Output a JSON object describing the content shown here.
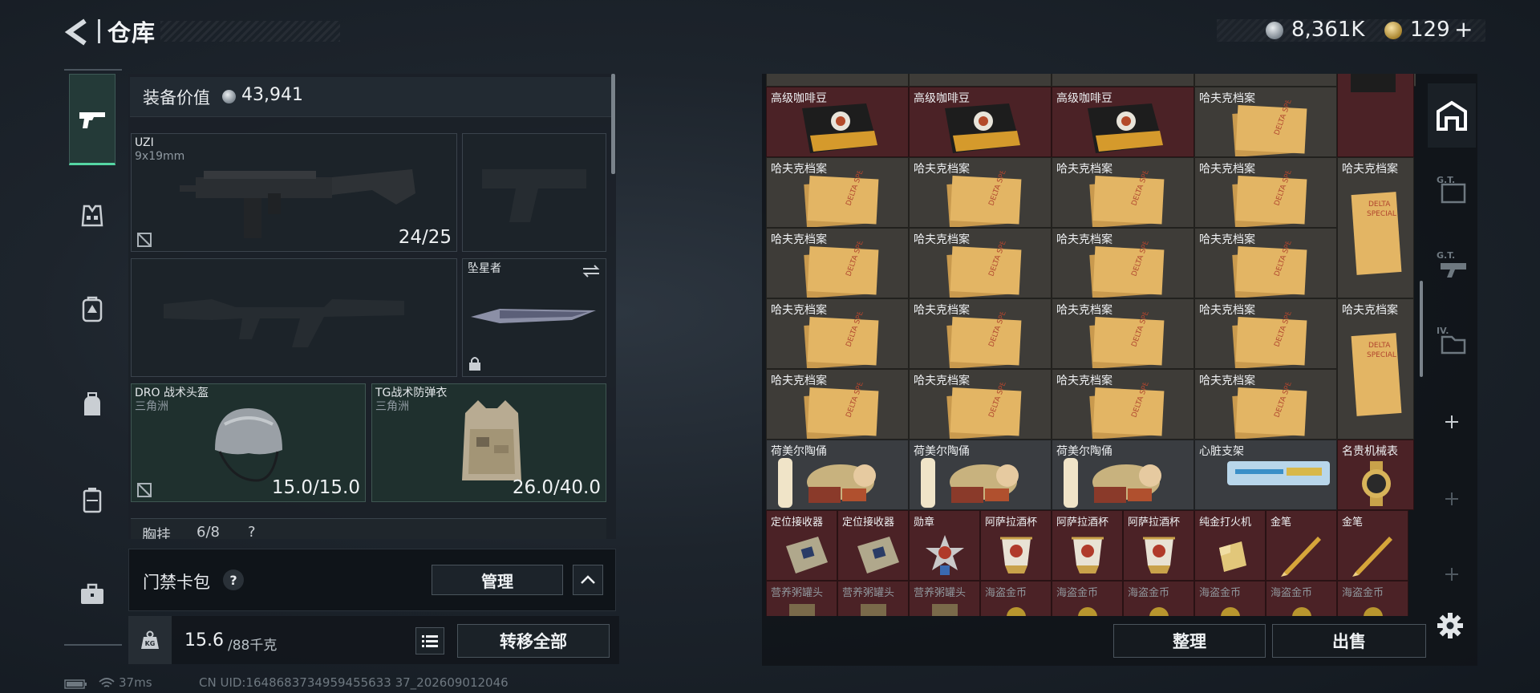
{
  "header": {
    "title": "仓库",
    "silver_amount": "8,361K",
    "gold_amount": "129",
    "gold_plus": "+"
  },
  "nav": {
    "items": [
      "gun-icon",
      "vest-icon",
      "backpack-armor-icon",
      "backpack-icon",
      "pouch-icon",
      "briefcase-icon"
    ]
  },
  "equipment": {
    "value_label": "装备价值",
    "value": "43,941",
    "primary": {
      "name": "UZI",
      "caliber": "9x19mm",
      "ammo": "24/25"
    },
    "melee": {
      "name": "坠星者"
    },
    "helmet": {
      "name": "DRO 战术头盔",
      "brand": "三角洲",
      "durability": "15.0/15.0"
    },
    "armor": {
      "name": "TG战术防弹衣",
      "brand": "三角洲",
      "durability": "26.0/40.0"
    },
    "chest_rig": {
      "label": "胸挂",
      "count": "6/8",
      "help": "?"
    }
  },
  "keycase": {
    "label": "门禁卡包",
    "help": "?",
    "manage": "管理"
  },
  "weight": {
    "current": "15.6",
    "max": "/88千克"
  },
  "transfer_all": "转移全部",
  "status": {
    "ping": "37ms",
    "uid": "CN UID:1648683734959455633 37_202609012046"
  },
  "storage": {
    "rows": [
      [
        {
          "label": "高级咖啡豆",
          "type": "coffee"
        },
        {
          "label": "高级咖啡豆",
          "type": "coffee"
        },
        {
          "label": "高级咖啡豆",
          "type": "coffee"
        },
        {
          "label": "哈夫克档案",
          "type": "file"
        },
        {
          "label": "",
          "type": "coffee-edge"
        }
      ],
      [
        {
          "label": "哈夫克档案",
          "type": "file"
        },
        {
          "label": "哈夫克档案",
          "type": "file"
        },
        {
          "label": "哈夫克档案",
          "type": "file"
        },
        {
          "label": "哈夫克档案",
          "type": "file"
        },
        {
          "label": "哈夫克档案",
          "type": "file-tall"
        }
      ],
      [
        {
          "label": "哈夫克档案",
          "type": "file"
        },
        {
          "label": "哈夫克档案",
          "type": "file"
        },
        {
          "label": "哈夫克档案",
          "type": "file"
        },
        {
          "label": "哈夫克档案",
          "type": "file"
        }
      ],
      [
        {
          "label": "哈夫克档案",
          "type": "file"
        },
        {
          "label": "哈夫克档案",
          "type": "file"
        },
        {
          "label": "哈夫克档案",
          "type": "file"
        },
        {
          "label": "哈夫克档案",
          "type": "file"
        },
        {
          "label": "哈夫克档案",
          "type": "file-tall"
        }
      ],
      [
        {
          "label": "哈夫克档案",
          "type": "file"
        },
        {
          "label": "哈夫克档案",
          "type": "file"
        },
        {
          "label": "哈夫克档案",
          "type": "file"
        },
        {
          "label": "哈夫克档案",
          "type": "file"
        }
      ],
      [
        {
          "label": "荷美尔陶俑",
          "type": "figurine"
        },
        {
          "label": "荷美尔陶俑",
          "type": "figurine"
        },
        {
          "label": "荷美尔陶俑",
          "type": "figurine"
        },
        {
          "label": "心脏支架",
          "type": "stent"
        },
        {
          "label": "名贵机械表",
          "type": "watch"
        }
      ],
      [
        {
          "label": "定位接收器",
          "type": "receiver"
        },
        {
          "label": "定位接收器",
          "type": "receiver"
        },
        {
          "label": "勋章",
          "type": "medal"
        },
        {
          "label": "阿萨拉酒杯",
          "type": "cup"
        },
        {
          "label": "阿萨拉酒杯",
          "type": "cup"
        },
        {
          "label": "阿萨拉酒杯",
          "type": "cup"
        },
        {
          "label": "纯金打火机",
          "type": "lighter"
        },
        {
          "label": "金笔",
          "type": "pen"
        },
        {
          "label": "金笔",
          "type": "pen"
        }
      ],
      [
        {
          "label": "营养粥罐头",
          "type": "can"
        },
        {
          "label": "营养粥罐头",
          "type": "can"
        },
        {
          "label": "营养粥罐头",
          "type": "can"
        },
        {
          "label": "海盗金币",
          "type": "coin"
        },
        {
          "label": "海盗金币",
          "type": "coin"
        },
        {
          "label": "海盗金币",
          "type": "coin"
        },
        {
          "label": "海盗金币",
          "type": "coin"
        },
        {
          "label": "海盗金币",
          "type": "coin"
        },
        {
          "label": "海盗金币",
          "type": "coin"
        }
      ]
    ],
    "side_tabs": [
      "storage-home-icon",
      "tab-g1-icon",
      "tab-g1-gun-icon",
      "tab-iv-icon",
      "add-tab-icon",
      "add-tab-icon",
      "add-tab-icon"
    ],
    "sort": "整理",
    "sell": "出售"
  },
  "colors": {
    "accent_green": "#55d6a4",
    "coffee_bg": "#4b2226",
    "file_bg": "#3e3c38",
    "file_paper": "#e3b564"
  }
}
